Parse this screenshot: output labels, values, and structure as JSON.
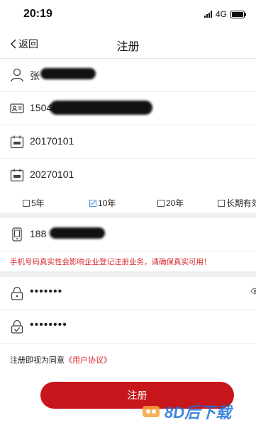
{
  "status_bar": {
    "time": "20:19",
    "network": "4G"
  },
  "nav": {
    "back_label": "返回",
    "title": "注册"
  },
  "fields": {
    "name": {
      "value": "张",
      "icon": "person-icon"
    },
    "id_number": {
      "value": "1504",
      "icon": "id-card-icon"
    },
    "start_date": {
      "value": "20170101",
      "icon": "calendar-icon"
    },
    "end_date": {
      "value": "20270101",
      "icon": "calendar-icon"
    }
  },
  "period_options": [
    {
      "label": "5年",
      "checked": false
    },
    {
      "label": "10年",
      "checked": true
    },
    {
      "label": "20年",
      "checked": false
    },
    {
      "label": "长期有效",
      "checked": false
    }
  ],
  "phone": {
    "value": "188",
    "icon": "phone-icon"
  },
  "warning": "手机号码真实性会影响企业登记注册业务，请确保真实可用！",
  "password": {
    "value": "•••••••",
    "icon": "lock-icon"
  },
  "confirm_password": {
    "value": "••••••••",
    "icon": "lock-check-icon"
  },
  "agreement": {
    "prefix": "注册即视为同意",
    "link": "《用户协议》"
  },
  "register_button": "注册",
  "watermark": {
    "text": "8D后下载"
  },
  "colors": {
    "accent": "#c8161d",
    "warning": "#d9262c",
    "checked": "#4a90d9"
  }
}
